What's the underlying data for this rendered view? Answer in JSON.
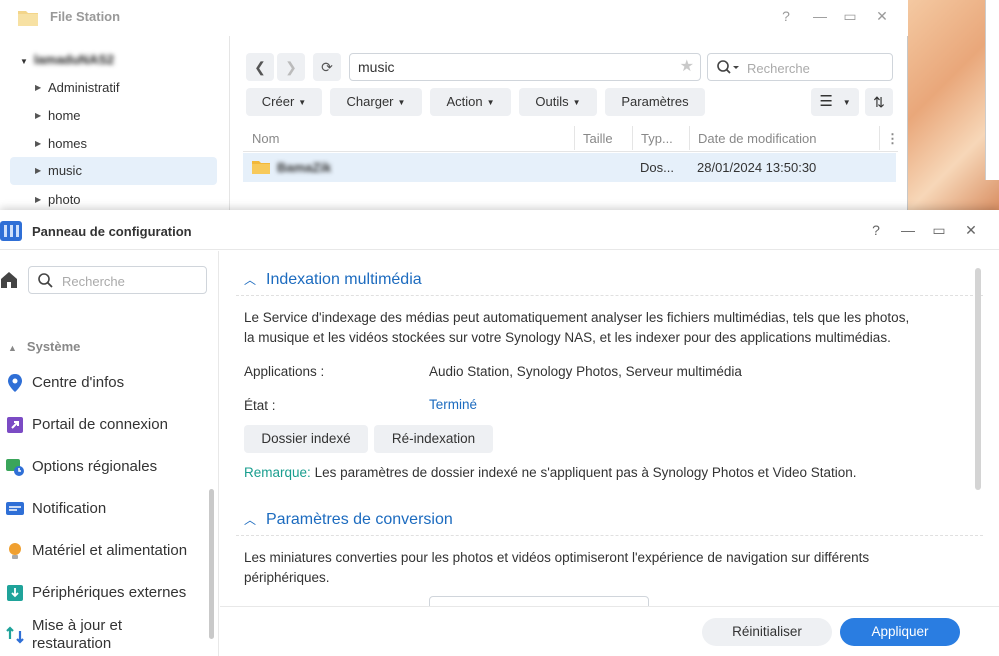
{
  "file_station": {
    "title": "File Station",
    "tree": {
      "root": "lamaduNAS2",
      "items": [
        "Administratif",
        "home",
        "homes",
        "music",
        "photo"
      ]
    },
    "path": "music",
    "search_placeholder": "Recherche",
    "toolbar": {
      "create": "Créer",
      "upload": "Charger",
      "action": "Action",
      "tools": "Outils",
      "settings": "Paramètres"
    },
    "columns": [
      "Nom",
      "Taille",
      "Typ...",
      "Date de modification"
    ],
    "rows": [
      {
        "name": "BamaZik",
        "size": "",
        "type": "Dos...",
        "modified": "28/01/2024 13:50:30"
      }
    ]
  },
  "control_panel": {
    "title": "Panneau de configuration",
    "search_placeholder": "Recherche",
    "category": "Système",
    "nav": [
      "Centre d'infos",
      "Portail de connexion",
      "Options régionales",
      "Notification",
      "Matériel et alimentation",
      "Périphériques externes",
      "Mise à jour et restauration"
    ],
    "sections": {
      "indexing": {
        "title": "Indexation multimédia",
        "description_line1": "Le Service d'indexage des médias peut automatiquement analyser les fichiers multimédias, tels que les photos,",
        "description_line2": "la musique et les vidéos stockées sur votre Synology NAS, et les indexer pour des applications multimédias.",
        "applications_label": "Applications :",
        "applications_value": "Audio Station, Synology Photos, Serveur multimédia",
        "state_label": "État :",
        "state_value": "Terminé",
        "btn_indexed_folder": "Dossier indexé",
        "btn_reindex": "Ré-indexation",
        "remark_label": "Remarque:",
        "remark_text": "Les paramètres de dossier indexé ne s'appliquent pas à Synology Photos et Video Station."
      },
      "conversion": {
        "title": "Paramètres de conversion",
        "description_line1": "Les miniatures converties pour les photos et vidéos optimiseront l'expérience de navigation sur différents",
        "description_line2": "périphériques."
      }
    },
    "footer": {
      "reset": "Réinitialiser",
      "apply": "Appliquer"
    }
  },
  "colors": {
    "accent": "#2a7de1",
    "link": "#1c6bbf",
    "remark": "#1a9e8f",
    "selection": "#e6f0fa"
  }
}
